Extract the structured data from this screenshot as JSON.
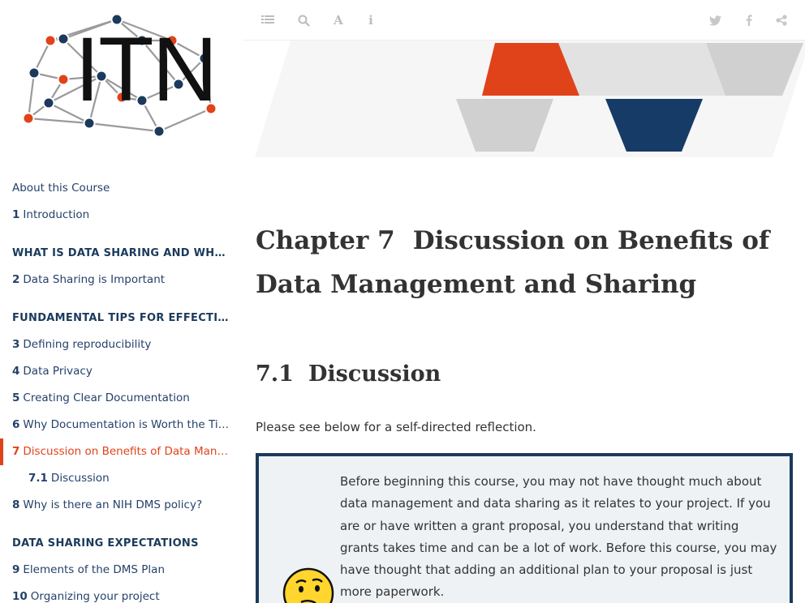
{
  "logo": {
    "text": "ITN"
  },
  "toolbar": {
    "left_icons": [
      "sidebar-toggle-icon",
      "search-icon",
      "font-settings-icon",
      "info-icon"
    ],
    "right_icons": [
      "twitter-icon",
      "facebook-icon",
      "share-icon"
    ]
  },
  "toc": [
    {
      "type": "item",
      "num": "",
      "label": "About this Course"
    },
    {
      "type": "item",
      "num": "1",
      "label": "Introduction"
    },
    {
      "type": "part",
      "num": "",
      "label": "WHAT IS DATA SHARING AND WHY IS IT IMPORTANT?"
    },
    {
      "type": "item",
      "num": "2",
      "label": "Data Sharing is Important"
    },
    {
      "type": "part",
      "num": "",
      "label": "FUNDAMENTAL TIPS FOR EFFECTIVE DATA MANAGEMENT"
    },
    {
      "type": "item",
      "num": "3",
      "label": "Defining reproducibility"
    },
    {
      "type": "item",
      "num": "4",
      "label": "Data Privacy"
    },
    {
      "type": "item",
      "num": "5",
      "label": "Creating Clear Documentation"
    },
    {
      "type": "item",
      "num": "6",
      "label": "Why Documentation is Worth the Time"
    },
    {
      "type": "active",
      "num": "7",
      "label": "Discussion on Benefits of Data Management and Sharing"
    },
    {
      "type": "sub",
      "num": "7.1",
      "label": "Discussion"
    },
    {
      "type": "item",
      "num": "8",
      "label": "Why is there an NIH DMS policy?"
    },
    {
      "type": "part",
      "num": "",
      "label": "DATA SHARING EXPECTATIONS"
    },
    {
      "type": "item",
      "num": "9",
      "label": "Elements of the DMS Plan"
    },
    {
      "type": "item",
      "num": "10",
      "label": "Organizing your project"
    }
  ],
  "chapter": {
    "num": "Chapter 7",
    "title": "Discussion on Benefits of Data Management and Sharing"
  },
  "section": {
    "num": "7.1",
    "title": "Discussion"
  },
  "intro": "Please see below for a self-directed reflection.",
  "reflection": {
    "text": "Before beginning this course, you may not have thought much about data management and data sharing as it relates to your project. If you are or have written a grant proposal, you understand that writing grants takes time and can be a lot of work. Before this course, you may have thought that adding an additional plan to your proposal is just more paperwork.",
    "icon": "thinking-face-icon"
  },
  "colors": {
    "accent": "#e0431a",
    "navy": "#1b3a5c",
    "banner_gray": "#d0d0d0",
    "reflection_bg": "#eef2f5"
  }
}
